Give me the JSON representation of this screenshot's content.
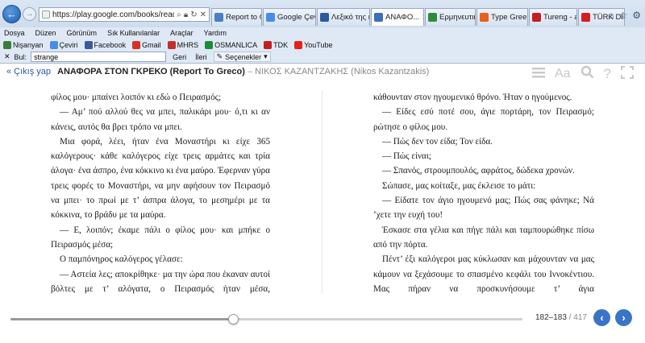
{
  "browser": {
    "address": "https://play.google.com/books/reader?printsec=fr",
    "tabs": [
      {
        "label": "Report to Gr...",
        "color": "#4a7fc1"
      },
      {
        "label": "Google Çeviri",
        "color": "#4a8bea"
      },
      {
        "label": "Λεξικό της κ...",
        "color": "#2c5aa0"
      },
      {
        "label": "ΑΝΑΦΟ...",
        "color": "#3b6fb8"
      },
      {
        "label": "Ερμηνευτικ...",
        "color": "#2e8b3a"
      },
      {
        "label": "Type Greek I...",
        "color": "#e8601c"
      },
      {
        "label": "Tureng - all...",
        "color": "#c41e1e"
      },
      {
        "label": "TÜRK DİL K...",
        "color": "#d21f1f"
      }
    ],
    "menu": [
      "Dosya",
      "Düzen",
      "Görünüm",
      "Sık Kullanılanlar",
      "Araçlar",
      "Yardım"
    ],
    "favorites": [
      {
        "label": "Nişanyan",
        "color": "#3a7d3a"
      },
      {
        "label": "Çeviri",
        "color": "#4a8bea"
      },
      {
        "label": "Facebook",
        "color": "#3b5998"
      },
      {
        "label": "Gmail",
        "color": "#d93025"
      },
      {
        "label": "MHRS",
        "color": "#c2302b"
      },
      {
        "label": "OSMANLICA",
        "color": "#1a8c3a"
      },
      {
        "label": "TDK",
        "color": "#c41e1e"
      },
      {
        "label": "YouTube",
        "color": "#e62117"
      }
    ],
    "find": {
      "label": "Bul:",
      "value": "strange",
      "prev": "Geri",
      "next": "İleri",
      "options": "Seçenekler"
    }
  },
  "reader": {
    "back_label": "« Çıkış yap",
    "title": "ΑΝΑΦΟΡΑ ΣΤΟΝ ΓΚΡΕΚΟ (Report To Greco)",
    "separator": "–",
    "author": "ΝΙΚΟΣ ΚΑΖΑΝΤΖΑΚΗΣ (Nikos Kazantzakis)",
    "tools": [
      "contents-icon",
      "font-size-icon",
      "search-icon",
      "help-icon",
      "fullscreen-icon"
    ],
    "font_label": "Aa"
  },
  "left_page": [
    "φίλος μου· μπαίνει λοιπόν κι εδώ ο Πειρασμός;",
    "— Αμ’ πού αλλού θες να μπει, παλικάρι μου· ό,τι κι αν κάνεις, αυτός θα βρει τρόπο να μπει.",
    "Μια φορά, λέει, ήταν ένα Μοναστήρι κι είχε 365 καλόγερους· κάθε καλόγερος είχε τρεις αρμάτες και τρία άλογα· ένα άσπρο, ένα κόκκινο κι ένα μαύρο. Έφερναν γύρα τρεις φορές το Μοναστήρι, να μην αφήσουν τον Πειρασμό να μπει· το πρωί με τ’ άσπρα άλογα, το μεσημέρι με τα κόκκινα, το βράδυ με τα μαύρα.",
    "— Ε, λοιπόν; έκαμε πάλι ο φίλος μου· και μπήκε ο Πειρασμός μέσα;",
    "Ο παμπόνηρος καλόγερος γέλασε:",
    "— Αστεία λες; αποκρίθηκε· μα την ώρα που έκαναν αυτοί βόλτες με τ’ αλόγατα, ο Πειρασμός ήταν μέσα,"
  ],
  "right_page": [
    "κάθουνταν στον ηγουμενικό θρόνο. Ήταν ο ηγούμενος.",
    "— Είδες εσύ ποτέ σου, άγιε πορτάρη, τον Πειρασμό; ρώτησε ο φίλος μου.",
    "— Πώς δεν τον είδα; Τον είδα.",
    "— Πώς είναι;",
    "— Σπανός, στρουμπουλός, αφράτος, δώδεκα χρονών.",
    "Σώπασε, μας κοίταξε, μας έκλεισε το μάτι:",
    "— Είδατε τον άγιο ηγουμενό μας; Πώς σας φάνηκε; Νά ’χετε την ευχή του!",
    "Έσκασε στα γέλια και πήγε πάλι και ταμπουρώθηκε πίσω από την πόρτα.",
    "Πέντ’ έξι καλόγεροι μας κύκλωσαν και μάχουνταν να μας κάμουν να ξεχάσουμε το σπασμένο κεφάλι του Ιννοκέντιου. Μας πήραν να προσκυνήσουμε τ’ άγια"
  ],
  "footer": {
    "current": "182–183",
    "separator": "/",
    "total": "417",
    "progress_fraction": 0.435
  },
  "colors": {
    "accent": "#3a74c7",
    "link": "#2b57a8"
  }
}
